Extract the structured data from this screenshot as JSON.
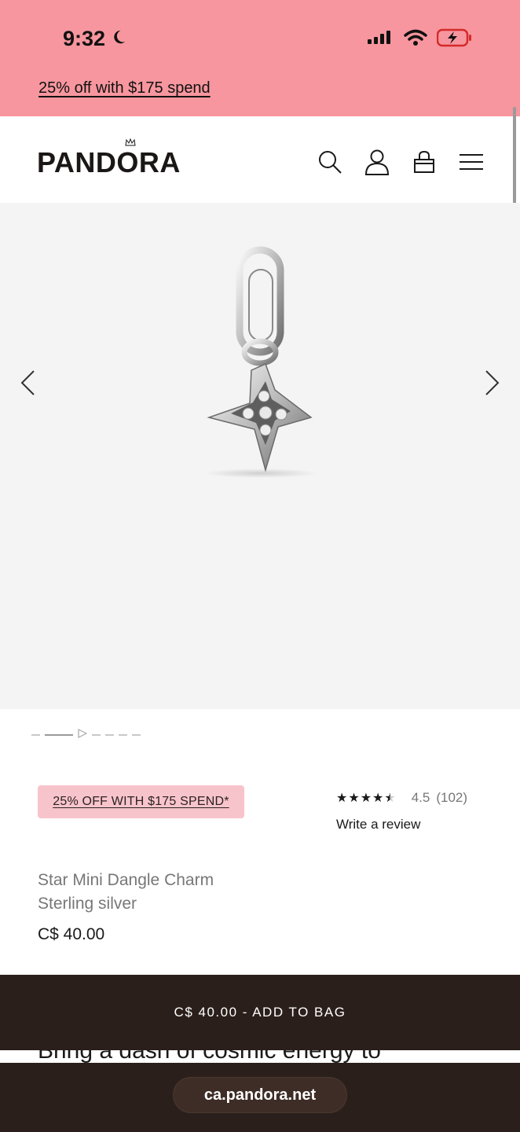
{
  "status_bar": {
    "time": "9:32"
  },
  "promo": {
    "text": "25% off with $175 spend"
  },
  "header": {
    "logo": "PANDORA"
  },
  "product": {
    "offer_badge": "25% OFF WITH $175 SPEND*",
    "rating_value": "4.5",
    "rating_count": "(102)",
    "rating_fraction": 0.9,
    "write_review": "Write a review",
    "name": "Star Mini Dangle Charm",
    "material": "Sterling silver",
    "price": "C$ 40.00"
  },
  "description": {
    "peek": "Bring a dash of cosmic energy to"
  },
  "cta": {
    "add_to_bag": "C$ 40.00 - ADD TO BAG"
  },
  "browser": {
    "url": "ca.pandora.net"
  },
  "colors": {
    "promo_bg": "#f7969e",
    "badge_bg": "#f8c4cc",
    "cta_bg": "#2b1f1b"
  },
  "icons": [
    "moon-icon",
    "signal-icon",
    "wifi-icon",
    "battery-charging-icon",
    "search-icon",
    "account-icon",
    "bag-icon",
    "menu-icon",
    "chevron-left-icon",
    "chevron-right-icon",
    "star-icon",
    "play-icon"
  ]
}
